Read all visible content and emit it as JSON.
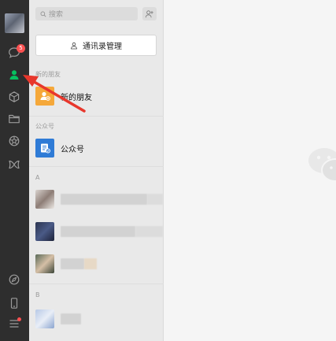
{
  "sidebar": {
    "chat_badge": "5",
    "icons": [
      "chat-icon",
      "contacts-icon",
      "favorites-icon",
      "files-icon",
      "moments-icon",
      "mini-programs-icon",
      "games-icon",
      "phone-icon",
      "menu-icon"
    ],
    "accent": "#07c160"
  },
  "contacts": {
    "search_placeholder": "搜索",
    "manage_label": "通讯录管理",
    "sections": {
      "new_friends_header": "新的朋友",
      "new_friends_item": "新的朋友",
      "official_header": "公众号",
      "official_item": "公众号",
      "group_a": "A",
      "group_b": "B"
    }
  },
  "colors": {
    "sidebar_bg": "#2e2e2e",
    "list_bg": "#e9e9e9",
    "new_friend_tile": "#f5a83a",
    "official_tile": "#2f7bd6",
    "arrow": "#e8372c",
    "badge": "#fa5151"
  }
}
